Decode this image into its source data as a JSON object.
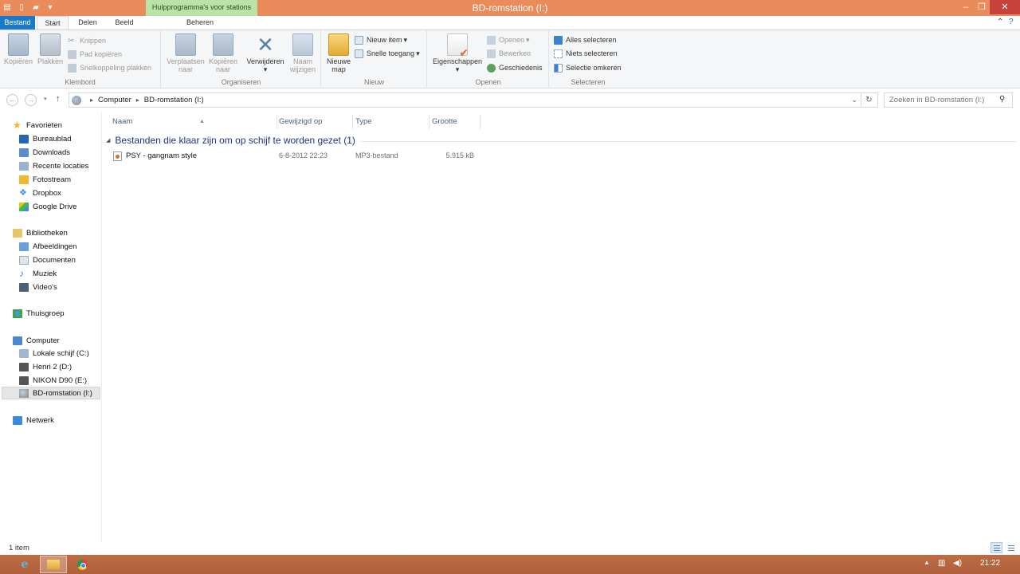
{
  "window": {
    "title": "BD-romstation (I:)",
    "context_tab": "Hulpprogramma's voor stations",
    "minimize": "–",
    "maximize": "❐",
    "close": "✕"
  },
  "ribbon_tabs": {
    "file": "Bestand",
    "start": "Start",
    "share": "Delen",
    "view": "Beeld",
    "manage": "Beheren"
  },
  "ribbon": {
    "clipboard": {
      "label": "Klembord",
      "copy": "Kopiëren",
      "paste": "Plakken",
      "cut": "Knippen",
      "copy_path": "Pad kopiëren",
      "paste_shortcut": "Snelkoppeling plakken"
    },
    "organize": {
      "label": "Organiseren",
      "move_to_1": "Verplaatsen",
      "move_to_2": "naar",
      "copy_to_1": "Kopiëren",
      "copy_to_2": "naar",
      "delete": "Verwijderen",
      "rename_1": "Naam",
      "rename_2": "wijzigen"
    },
    "new": {
      "label": "Nieuw",
      "new_folder_1": "Nieuwe",
      "new_folder_2": "map",
      "new_item": "Nieuw item",
      "easy_access": "Snelle toegang"
    },
    "open": {
      "label": "Openen",
      "properties": "Eigenschappen",
      "open": "Openen",
      "edit": "Bewerken",
      "history": "Geschiedenis"
    },
    "select": {
      "label": "Selecteren",
      "select_all": "Alles selecteren",
      "select_none": "Niets selecteren",
      "invert": "Selectie omkeren"
    }
  },
  "address": {
    "crumbs": [
      "Computer",
      "BD-romstation (I:)"
    ],
    "search_placeholder": "Zoeken in BD-romstation (I:)"
  },
  "nav": {
    "favorites": "Favorieten",
    "favorites_items": [
      "Bureaublad",
      "Downloads",
      "Recente locaties",
      "Fotostream",
      "Dropbox",
      "Google Drive"
    ],
    "libraries": "Bibliotheken",
    "libraries_items": [
      "Afbeeldingen",
      "Documenten",
      "Muziek",
      "Video's"
    ],
    "homegroup": "Thuisgroep",
    "computer": "Computer",
    "computer_items": [
      "Lokale schijf (C:)",
      "Henri 2 (D:)",
      "NIKON D90 (E:)",
      "BD-romstation (I:)"
    ],
    "network": "Netwerk"
  },
  "columns": {
    "name": "Naam",
    "modified": "Gewijzigd op",
    "type": "Type",
    "size": "Grootte"
  },
  "group": {
    "title": "Bestanden die klaar zijn om op schijf te worden gezet (1)"
  },
  "files": [
    {
      "name": "PSY - gangnam style",
      "modified": "6-8-2012 22:23",
      "type": "MP3-bestand",
      "size": "5.915 kB"
    }
  ],
  "status": {
    "count": "1 item"
  },
  "taskbar": {
    "time": "21:22"
  }
}
